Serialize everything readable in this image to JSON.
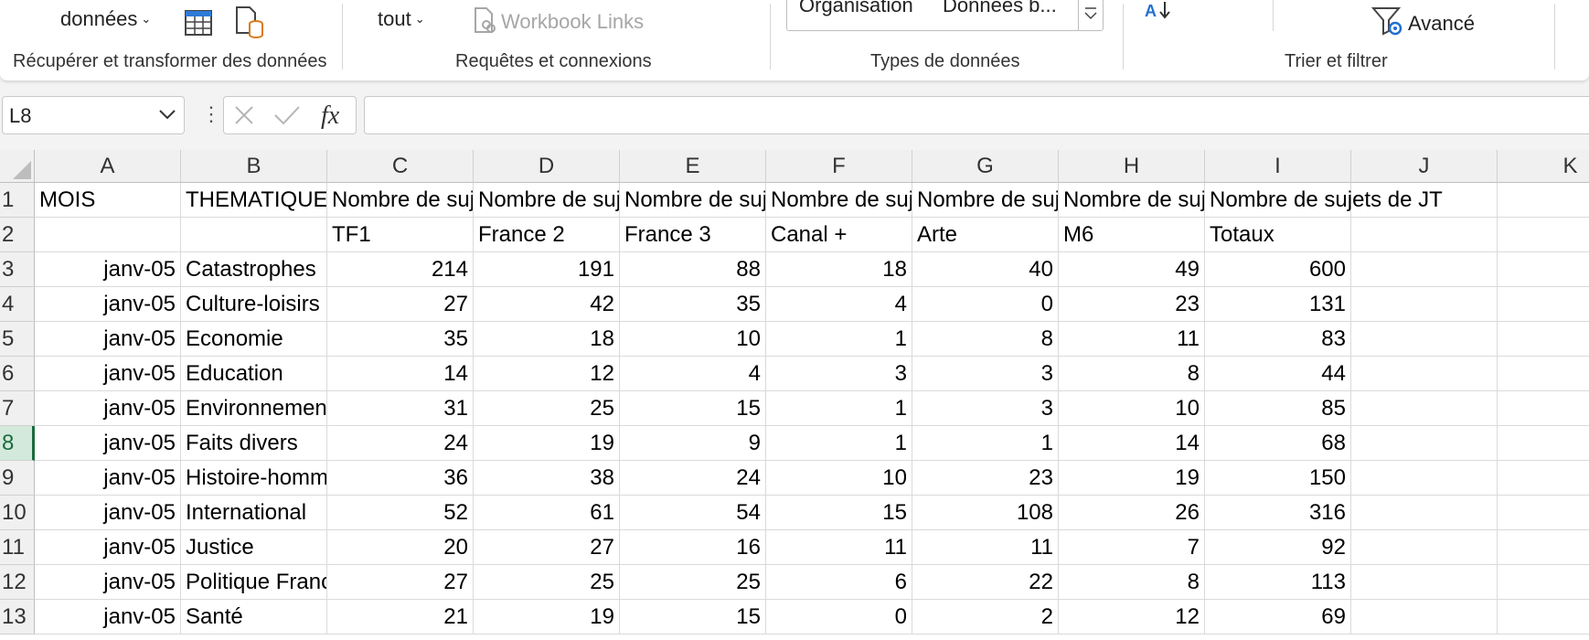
{
  "ribbon": {
    "get_data_label": "données",
    "get_transform_group": "Récupérer et transformer des données",
    "refresh_all_label": "tout",
    "workbook_links_label": "Workbook Links",
    "queries_group": "Requêtes et connexions",
    "data_types": [
      "Organisation",
      "Données b..."
    ],
    "data_types_group": "Types de données",
    "advanced_label": "Avancé",
    "sort_filter_group": "Trier et filtrer"
  },
  "formula_bar": {
    "name_box": "L8",
    "formula": ""
  },
  "sheet": {
    "columns": [
      "A",
      "B",
      "C",
      "D",
      "E",
      "F",
      "G",
      "H",
      "I",
      "J",
      "K"
    ],
    "active_row": 8,
    "header_row1": {
      "A": "MOIS",
      "B": "THEMATIQUE",
      "C": "Nombre de sujets de JT",
      "D": "Nombre de sujets de JT",
      "E": "Nombre de sujets de JT",
      "F": "Nombre de sujets de JT",
      "G": "Nombre de sujets de JT",
      "H": "Nombre de sujets de JT",
      "I": "Nombre de sujets de JT"
    },
    "header_row2": [
      "TF1",
      "France 2",
      "France 3",
      "Canal +",
      "Arte",
      "M6",
      "Totaux"
    ],
    "rows": [
      {
        "row": 3,
        "mois": "janv-05",
        "theme": "Catastrophes",
        "values": [
          214,
          191,
          88,
          18,
          40,
          49,
          600
        ]
      },
      {
        "row": 4,
        "mois": "janv-05",
        "theme": "Culture-loisirs",
        "values": [
          27,
          42,
          35,
          4,
          0,
          23,
          131
        ]
      },
      {
        "row": 5,
        "mois": "janv-05",
        "theme": "Economie",
        "values": [
          35,
          18,
          10,
          1,
          8,
          11,
          83
        ]
      },
      {
        "row": 6,
        "mois": "janv-05",
        "theme": "Education",
        "values": [
          14,
          12,
          4,
          3,
          3,
          8,
          44
        ]
      },
      {
        "row": 7,
        "mois": "janv-05",
        "theme": "Environnement",
        "values": [
          31,
          25,
          15,
          1,
          3,
          10,
          85
        ]
      },
      {
        "row": 8,
        "mois": "janv-05",
        "theme": "Faits divers",
        "values": [
          24,
          19,
          9,
          1,
          1,
          14,
          68
        ]
      },
      {
        "row": 9,
        "mois": "janv-05",
        "theme": "Histoire-hommages",
        "values": [
          36,
          38,
          24,
          10,
          23,
          19,
          150
        ]
      },
      {
        "row": 10,
        "mois": "janv-05",
        "theme": "International",
        "values": [
          52,
          61,
          54,
          15,
          108,
          26,
          316
        ]
      },
      {
        "row": 11,
        "mois": "janv-05",
        "theme": "Justice",
        "values": [
          20,
          27,
          16,
          11,
          11,
          7,
          92
        ]
      },
      {
        "row": 12,
        "mois": "janv-05",
        "theme": "Politique France",
        "values": [
          27,
          25,
          25,
          6,
          22,
          8,
          113
        ]
      },
      {
        "row": 13,
        "mois": "janv-05",
        "theme": "Santé",
        "values": [
          21,
          19,
          15,
          0,
          2,
          12,
          69
        ]
      }
    ]
  },
  "colors": {
    "active_row_header_bg": "#d3e9dc",
    "active_row_header_fg": "#1b6b3e",
    "sort_arrow_blue": "#1f6fd1"
  }
}
